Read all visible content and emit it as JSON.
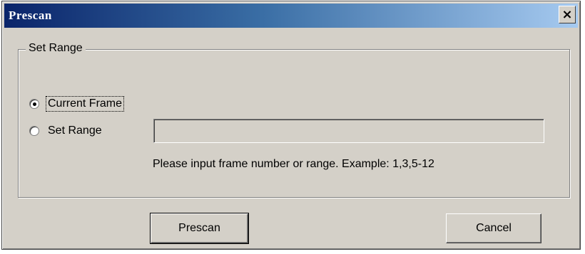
{
  "window": {
    "title": "Prescan",
    "close_glyph": "×"
  },
  "group": {
    "legend": "Set Range"
  },
  "options": {
    "current_frame_label": "Current Frame",
    "set_range_label": "Set Range",
    "selected": "current_frame"
  },
  "range_input": {
    "value": "",
    "placeholder": ""
  },
  "hint": "Please input frame number or range. Example: 1,3,5-12",
  "buttons": {
    "prescan_label": "Prescan",
    "cancel_label": "Cancel"
  },
  "colors": {
    "titlebar_start": "#0a246a",
    "titlebar_end": "#a6caf0",
    "dialog_face": "#d4d0c8"
  }
}
